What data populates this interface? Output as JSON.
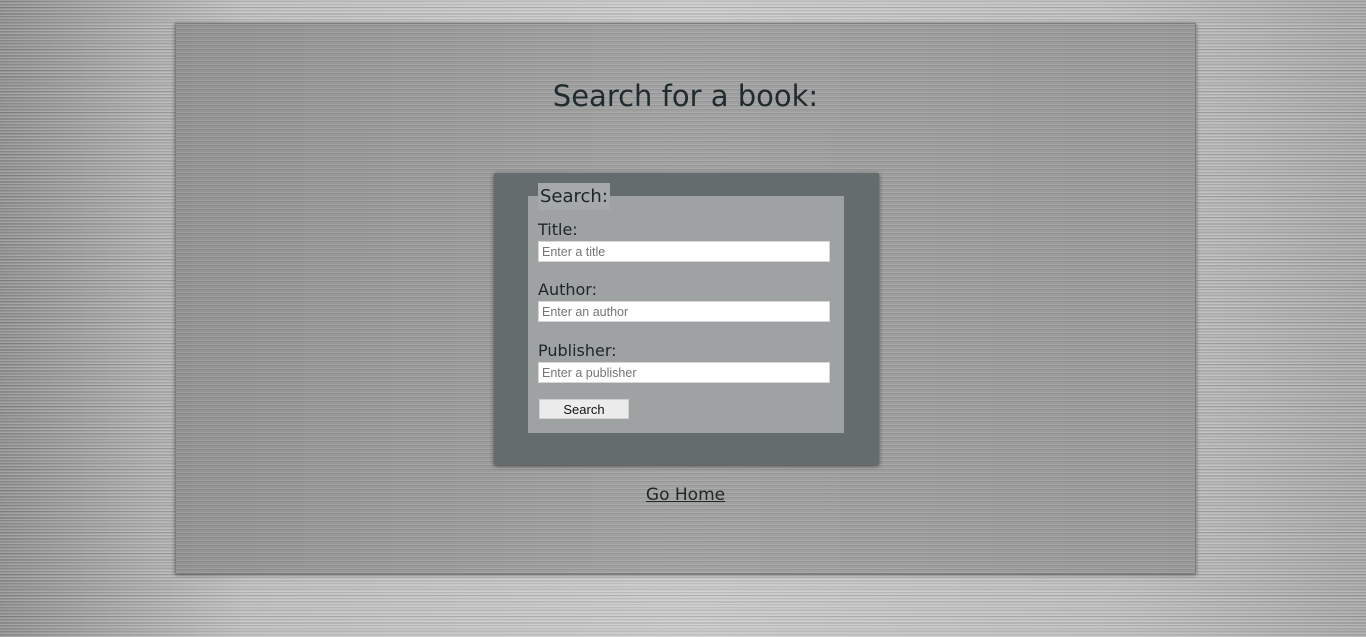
{
  "page": {
    "heading": "Search for a book:"
  },
  "form": {
    "legend": "Search:",
    "title_label": "Title:",
    "title_placeholder": "Enter a title",
    "title_value": "",
    "author_label": "Author:",
    "author_placeholder": "Enter an author",
    "author_value": "",
    "publisher_label": "Publisher:",
    "publisher_placeholder": "Enter a publisher",
    "publisher_value": "",
    "submit_label": "Search"
  },
  "footer": {
    "home_link": "Go Home"
  },
  "colors": {
    "form_box_bg": "#646c6e",
    "fieldset_bg": "#9ea2a3",
    "text_dark": "#1f2b2e"
  }
}
